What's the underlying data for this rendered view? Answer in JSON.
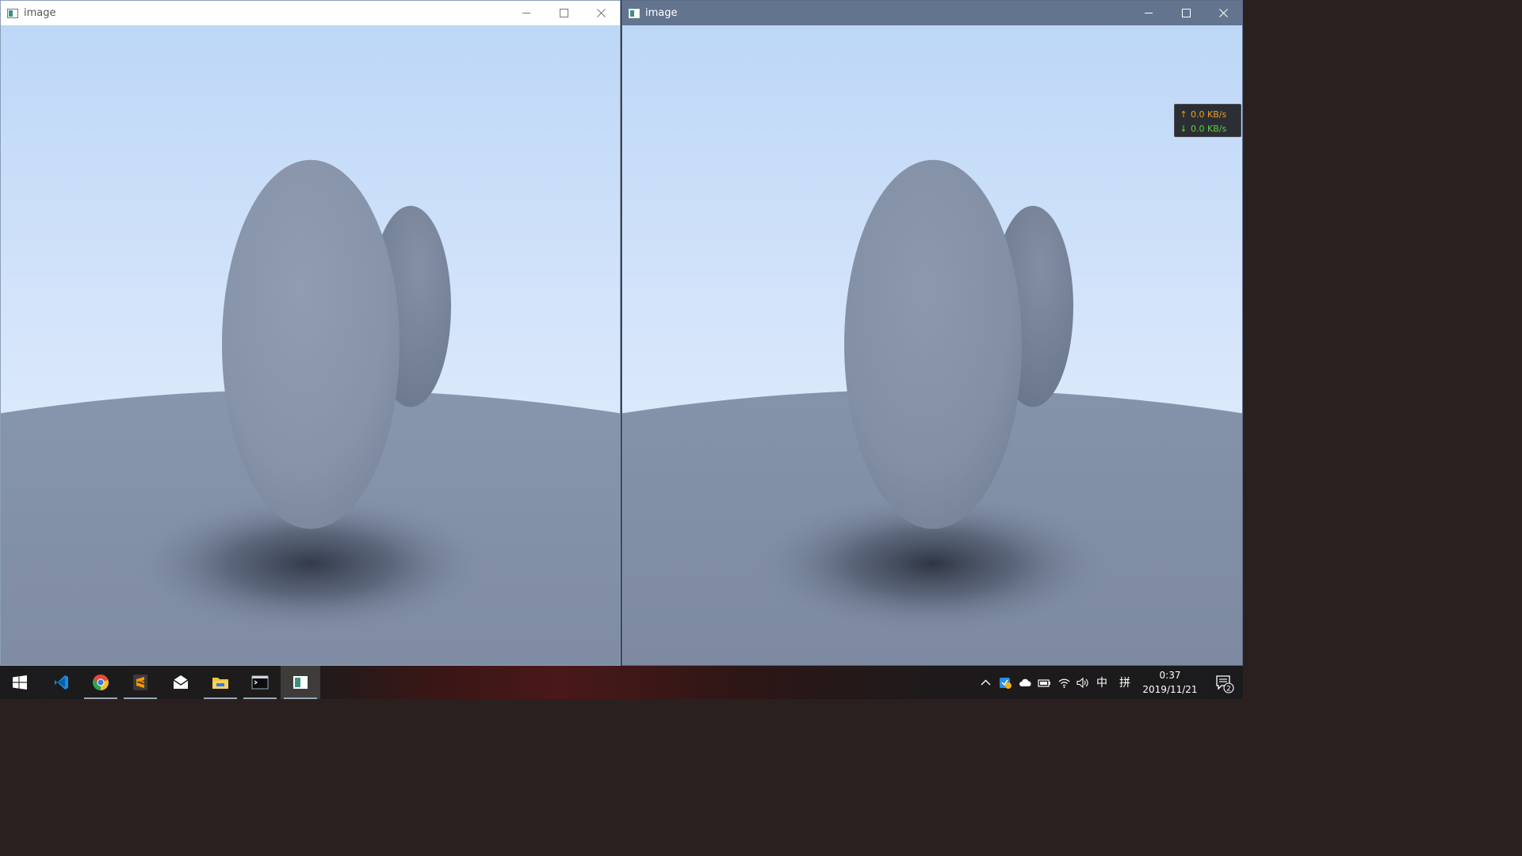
{
  "windows": {
    "left": {
      "title": "image",
      "state": "inactive"
    },
    "right": {
      "title": "image",
      "state": "active"
    }
  },
  "net_widget": {
    "upload": "0.0 KB/s",
    "download": "0.0 KB/s",
    "upload_color": "#f0a020",
    "download_color": "#60d040"
  },
  "taskbar": {
    "apps": [
      {
        "name": "start",
        "icon": "windows-logo-icon"
      },
      {
        "name": "visual-studio-code",
        "icon": "vscode-icon"
      },
      {
        "name": "chrome",
        "icon": "chrome-icon",
        "running": true
      },
      {
        "name": "sublime-text",
        "icon": "sublime-icon",
        "running": true
      },
      {
        "name": "mail",
        "icon": "mail-icon"
      },
      {
        "name": "file-explorer",
        "icon": "folder-icon",
        "running": true
      },
      {
        "name": "terminal",
        "icon": "terminal-icon",
        "running": true
      },
      {
        "name": "image-viewer",
        "icon": "image-window-icon",
        "running": true,
        "active": true
      }
    ],
    "tray": {
      "ime_label": "中",
      "ime_mode": "拼",
      "icons": [
        "chevron-up-icon",
        "weather-app-icon",
        "onedrive-cloud-icon",
        "battery-icon",
        "wifi-icon",
        "volume-icon"
      ]
    },
    "clock": {
      "time": "0:37",
      "date": "2019/11/21"
    },
    "notifications": {
      "count": "2"
    }
  },
  "colors": {
    "sky_top": "#bcd7f8",
    "sky_bottom": "#e6f0fd",
    "ground": "#8090a8",
    "sphere": "#8794ab",
    "active_titlebar": "#63748f"
  }
}
